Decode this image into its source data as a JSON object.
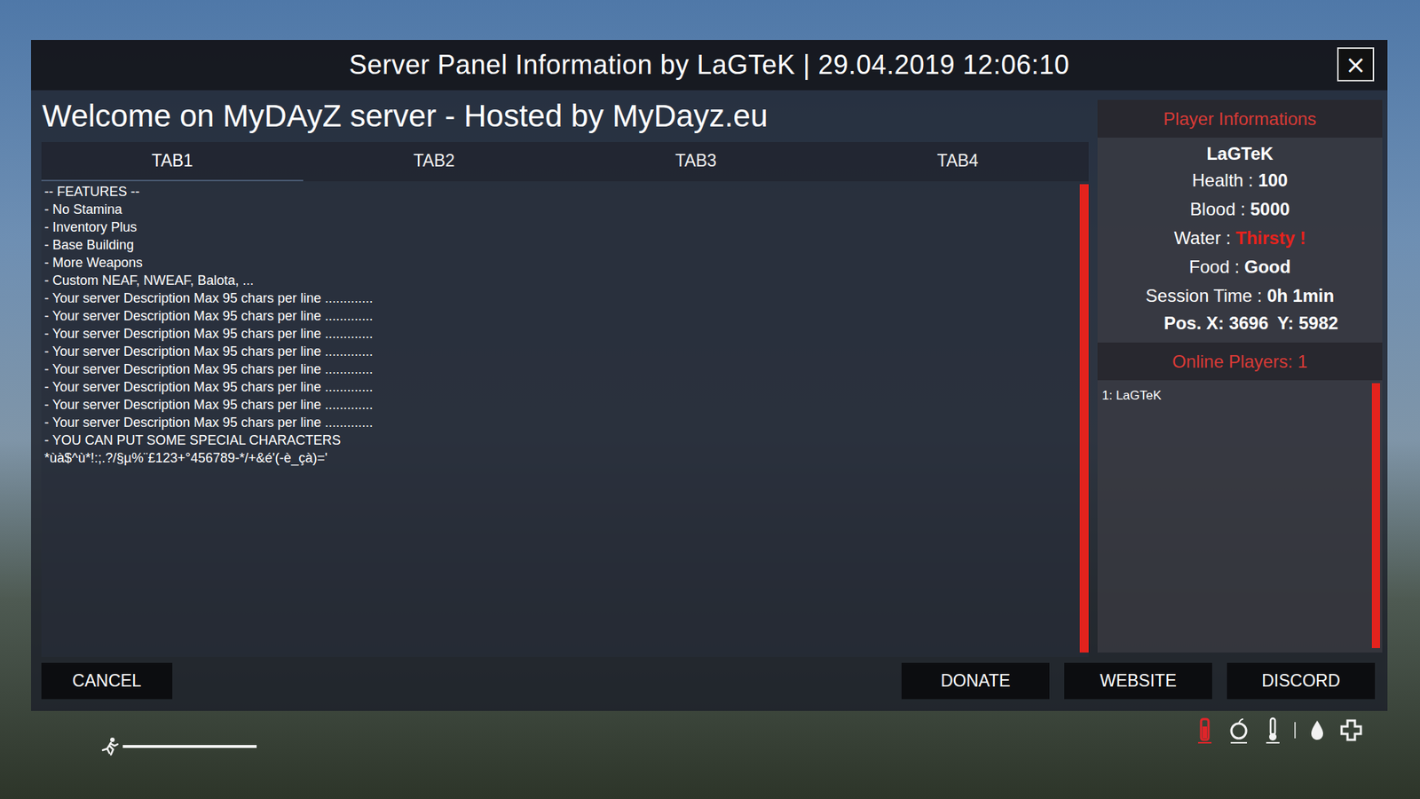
{
  "window": {
    "title": "Server Panel Information by LaGTeK | 29.04.2019 12:06:10",
    "close": "×"
  },
  "welcome": "Welcome on MyDAyZ server - Hosted by MyDayz.eu",
  "tabs": [
    {
      "label": "TAB1",
      "selected": true
    },
    {
      "label": "TAB2",
      "selected": false
    },
    {
      "label": "TAB3",
      "selected": false
    },
    {
      "label": "TAB4",
      "selected": false
    }
  ],
  "content_lines": [
    "-- FEATURES --",
    "- No Stamina",
    "- Inventory Plus",
    "- Base Building",
    "- More Weapons",
    "- Custom NEAF, NWEAF, Balota, ...",
    "- Your server Description Max 95 chars per line .............",
    "- Your server Description Max 95 chars per line .............",
    "- Your server Description Max 95 chars per line .............",
    "- Your server Description Max 95 chars per line .............",
    "- Your server Description Max 95 chars per line .............",
    "- Your server Description Max 95 chars per line .............",
    "- Your server Description Max 95 chars per line .............",
    "- Your server Description Max 95 chars per line .............",
    "- YOU CAN PUT SOME SPECIAL CHARACTERS",
    "*ùà$^ù*!:;.?/§µ%¨£123+°456789-*/+&é'(-è_çà)='"
  ],
  "player_info": {
    "header": "Player Informations",
    "name": "LaGTeK",
    "stats": [
      {
        "label": "Health :",
        "value": "100",
        "warning": false
      },
      {
        "label": "Blood :",
        "value": "5000",
        "warning": false
      },
      {
        "label": "Water :",
        "value": "Thirsty !",
        "warning": true
      },
      {
        "label": "Food :",
        "value": "Good",
        "warning": false
      },
      {
        "label": "Session Time :",
        "value": "0h 1min",
        "warning": false
      }
    ],
    "position": {
      "x_label": "Pos. X:",
      "x": "3696",
      "y_label": "Y:",
      "y": "5982"
    }
  },
  "online": {
    "header": "Online Players: 1",
    "players": [
      "1: LaGTeK"
    ]
  },
  "buttons": {
    "left": [
      "CANCEL"
    ],
    "right": [
      "DONATE",
      "WEBSITE",
      "DISCORD"
    ]
  },
  "hud": {
    "stamina": {
      "level": 1
    },
    "status_icons": [
      {
        "kind": "blood",
        "color": "#e0252a"
      },
      {
        "kind": "food",
        "color": "#f2f2f2"
      },
      {
        "kind": "temperature",
        "color": "#f2f2f2"
      },
      {
        "kind": "water",
        "color": "#f2f2f2"
      },
      {
        "kind": "health",
        "color": "#f2f2f2"
      }
    ]
  }
}
